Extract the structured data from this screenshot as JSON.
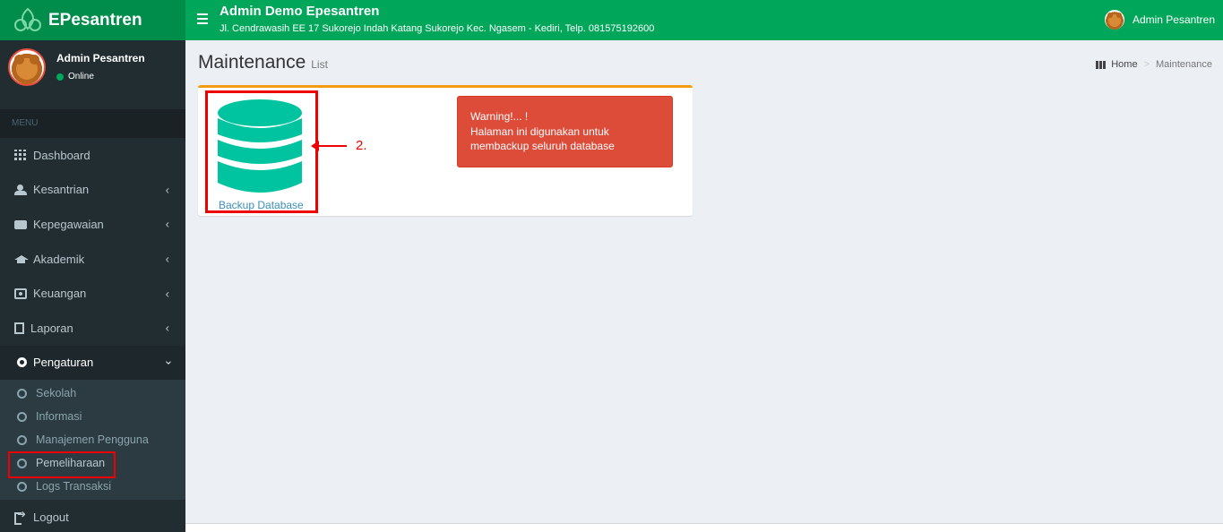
{
  "brand": {
    "name": "EPesantren",
    "logo_caption": "e-Pesantren"
  },
  "header": {
    "title": "Admin Demo Epesantren",
    "address": "Jl. Cendrawasih EE 17 Sukorejo Indah Katang Sukorejo Kec. Ngasem - Kediri, Telp. 081575192600",
    "user_name": "Admin Pesantren"
  },
  "sidebar": {
    "user_name": "Admin Pesantren",
    "status": "Online",
    "menu_header": "MENU",
    "items": [
      {
        "label": "Dashboard",
        "icon": "dashboard-grid-icon"
      },
      {
        "label": "Kesantrian",
        "icon": "users-icon"
      },
      {
        "label": "Kepegawaian",
        "icon": "briefcase-icon"
      },
      {
        "label": "Akademik",
        "icon": "graduation-cap-icon"
      },
      {
        "label": "Keuangan",
        "icon": "money-icon"
      },
      {
        "label": "Laporan",
        "icon": "file-icon"
      },
      {
        "label": "Pengaturan",
        "icon": "gear-icon"
      }
    ],
    "submenu": [
      {
        "label": "Sekolah"
      },
      {
        "label": "Informasi"
      },
      {
        "label": "Manajemen Pengguna"
      },
      {
        "label": "Pemeliharaan"
      },
      {
        "label": "Logs Transaksi"
      }
    ],
    "logout": "Logout"
  },
  "content": {
    "title": "Maintenance",
    "subtitle": "List",
    "breadcrumb": {
      "home": "Home",
      "current": "Maintenance"
    },
    "backup_label": "Backup Database",
    "annotation": "2.",
    "warning": {
      "line1": "Warning!... !",
      "line2": "Halaman ini digunakan untuk membackup seluruh database"
    }
  },
  "colors": {
    "header": "#00a65a",
    "logo_bg": "#008d4c",
    "sidebar": "#222d32",
    "db_icon": "#00c4a0",
    "warning": "#dd4b39",
    "box_border": "#f39c12",
    "highlight": "#ee0000"
  }
}
